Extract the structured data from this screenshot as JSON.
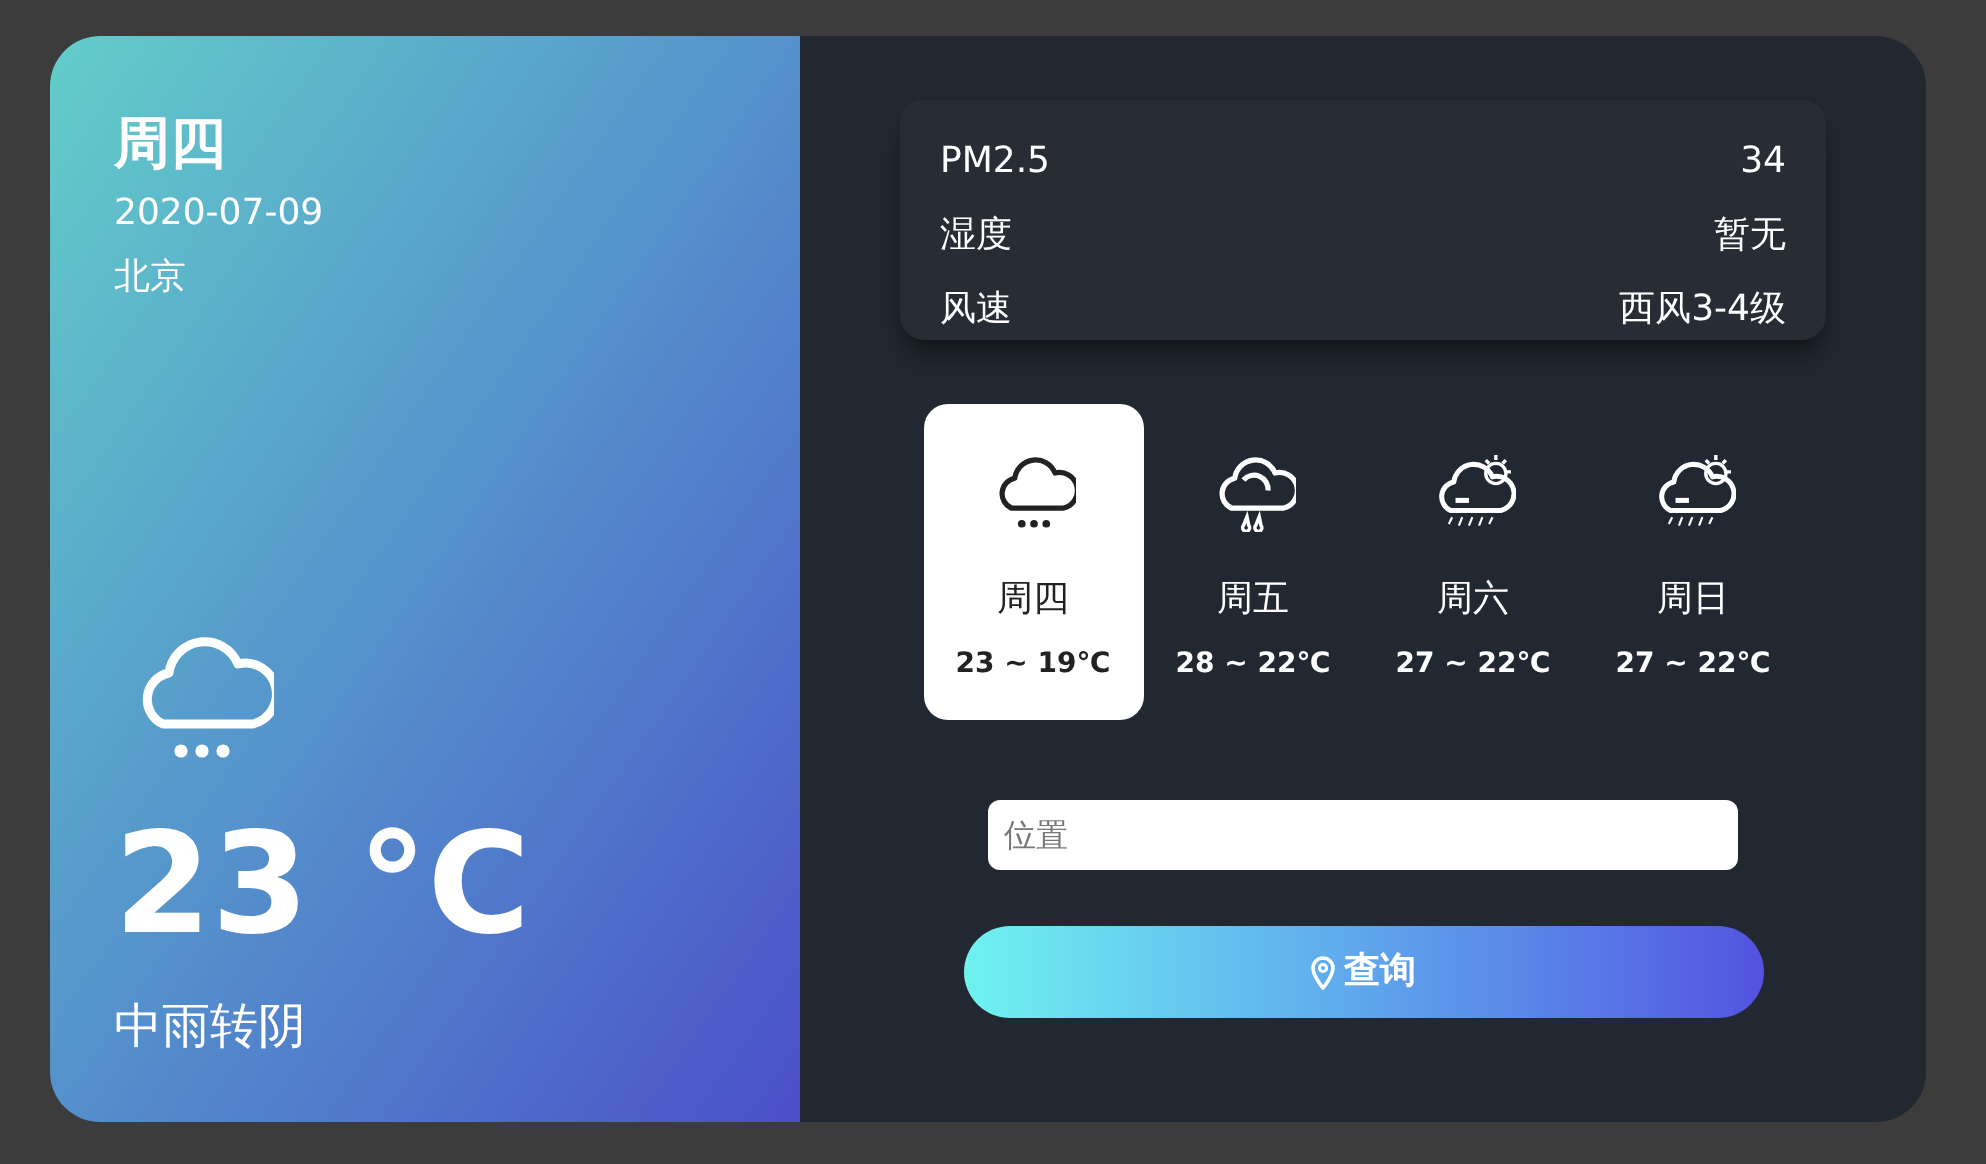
{
  "today": {
    "weekday": "周四",
    "date": "2020-07-09",
    "city": "北京",
    "kind": "rain-dots",
    "temperature": "23 °C",
    "description": "中雨转阴"
  },
  "details": [
    {
      "label": "PM2.5",
      "value": "34"
    },
    {
      "label": "湿度",
      "value": "暂无"
    },
    {
      "label": "风速",
      "value": "西风3-4级"
    }
  ],
  "forecast": [
    {
      "kind": "rain-dots",
      "weekday": "周四",
      "range": "23 ~ 19℃",
      "selected": true
    },
    {
      "kind": "rain-drops",
      "weekday": "周五",
      "range": "28 ~ 22℃",
      "selected": false
    },
    {
      "kind": "sun-rain",
      "weekday": "周六",
      "range": "27 ~ 22℃",
      "selected": false
    },
    {
      "kind": "sun-rain",
      "weekday": "周日",
      "range": "27 ~ 22℃",
      "selected": false
    }
  ],
  "search": {
    "placeholder": "位置"
  },
  "button": {
    "label": "查询"
  }
}
